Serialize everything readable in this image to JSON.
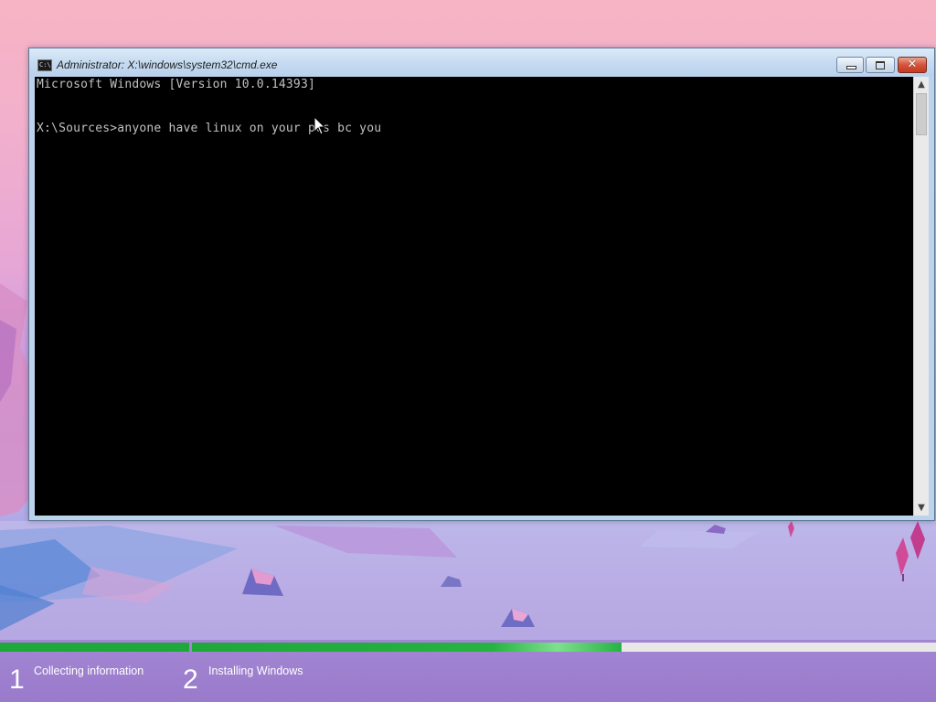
{
  "window": {
    "title": "Administrator: X:\\windows\\system32\\cmd.exe",
    "icon": "cmd-icon",
    "icon_text": "C:\\"
  },
  "console": {
    "lines": [
      "Microsoft Windows [Version 10.0.14393]",
      "X:\\Sources>anyone have linux on your pcs bc you"
    ]
  },
  "controls": {
    "close_glyph": "✕",
    "scroll_up_glyph": "▲",
    "scroll_down_glyph": "▼"
  },
  "setup": {
    "steps": [
      {
        "number": "1",
        "label": "Collecting information",
        "progress": 1.0
      },
      {
        "number": "2",
        "label": "Installing Windows",
        "progress": 0.577
      }
    ]
  },
  "colors": {
    "progress_green": "#1fa83a",
    "console_bg": "#000000",
    "console_text": "#c0c0c0"
  }
}
